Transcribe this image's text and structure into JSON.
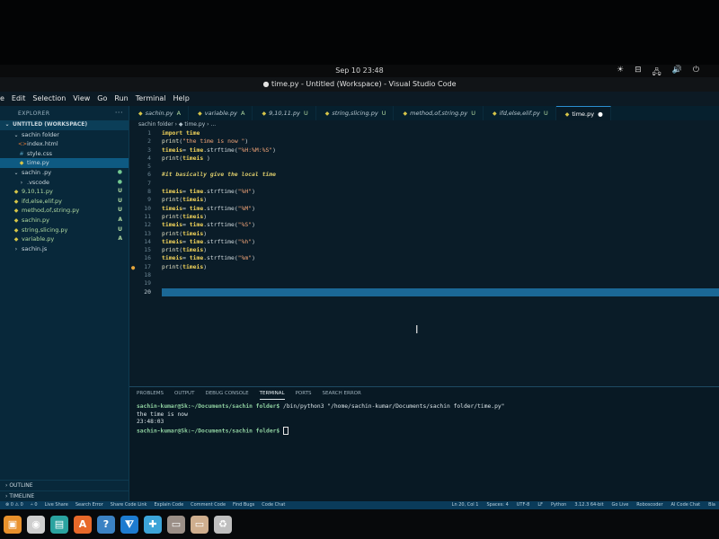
{
  "system": {
    "clock": "Sep 10  23:48",
    "tray": [
      "☀",
      "⊟",
      "🖧",
      "🔊",
      "⏻"
    ]
  },
  "window": {
    "title": "● time.py - Untitled (Workspace) - Visual Studio Code"
  },
  "menu": [
    "e",
    "Edit",
    "Selection",
    "View",
    "Go",
    "Run",
    "Terminal",
    "Help"
  ],
  "explorer": {
    "header": "EXPLORER",
    "more": "···",
    "workspace": "UNTITLED (WORKSPACE)",
    "items": [
      {
        "label": "sachin folder",
        "icon": "⌄",
        "indent": 14,
        "color": "",
        "badge": "",
        "sel": false
      },
      {
        "label": "index.html",
        "icon": "<>",
        "indent": 20,
        "color": "c-orange",
        "badge": "",
        "sel": false
      },
      {
        "label": "style.css",
        "icon": "#",
        "indent": 20,
        "color": "c-blue",
        "badge": "",
        "sel": false
      },
      {
        "label": "time.py",
        "icon": "◆",
        "indent": 20,
        "color": "c-yellow",
        "badge": "",
        "sel": true
      },
      {
        "label": "sachin .py",
        "icon": "⌄",
        "indent": 14,
        "color": "",
        "badge": "●",
        "sel": false
      },
      {
        "label": ".vscode",
        "icon": "›",
        "indent": 20,
        "color": "",
        "badge": "●",
        "sel": false
      },
      {
        "label": "9,10,11.py",
        "icon": "◆",
        "indent": 14,
        "color": "c-yellow",
        "badge": "U",
        "sel": false
      },
      {
        "label": "ifd,else,elif.py",
        "icon": "◆",
        "indent": 14,
        "color": "c-yellow",
        "badge": "U",
        "sel": false
      },
      {
        "label": "method,of,string.py",
        "icon": "◆",
        "indent": 14,
        "color": "c-yellow",
        "badge": "U",
        "sel": false
      },
      {
        "label": "sachin.py",
        "icon": "◆",
        "indent": 14,
        "color": "c-yellow",
        "badge": "A",
        "sel": false
      },
      {
        "label": "string,slicing.py",
        "icon": "◆",
        "indent": 14,
        "color": "c-yellow",
        "badge": "U",
        "sel": false
      },
      {
        "label": "variable.py",
        "icon": "◆",
        "indent": 14,
        "color": "c-yellow",
        "badge": "A",
        "sel": false
      },
      {
        "label": "sachin.js",
        "icon": "›",
        "indent": 14,
        "color": "",
        "badge": "",
        "sel": false
      }
    ],
    "outline": "OUTLINE",
    "timeline": "TIMELINE"
  },
  "tabs": [
    {
      "label": "sachin.py",
      "mark": "A",
      "active": false
    },
    {
      "label": "variable.py",
      "mark": "A",
      "active": false
    },
    {
      "label": "9,10,11.py",
      "mark": "U",
      "active": false
    },
    {
      "label": "string,slicing.py",
      "mark": "U",
      "active": false
    },
    {
      "label": "method,of,string.py",
      "mark": "U",
      "active": false
    },
    {
      "label": "ifd,else,elif.py",
      "mark": "U",
      "active": false
    },
    {
      "label": "time.py",
      "mark": "●",
      "active": true
    }
  ],
  "breadcrumb": "sachin folder  ›  ◆ time.py  ›  ...",
  "editor": {
    "lines": [
      "import time",
      "print(\"the time is now \")",
      "timeis= time.strftime(\"%H:%M:%S\")",
      "print(timeis )",
      "",
      "#it basically give the local time",
      "",
      "timeis= time.strftime(\"%H\")",
      "print(timeis)",
      "timeis= time.strftime(\"%M\")",
      "print(timeis)",
      "timeis= time.strftime(\"%S\")",
      "print(timeis)",
      "timeis= time.strftime(\"%h\")",
      "print(timeis)",
      "timeis= time.strftime(\"%m\")",
      "print(timeis)",
      "",
      "",
      ""
    ],
    "modified_line": 17,
    "current_line": 20
  },
  "panel": {
    "tabs": [
      "PROBLEMS",
      "OUTPUT",
      "DEBUG CONSOLE",
      "TERMINAL",
      "PORTS",
      "SEARCH ERROR"
    ],
    "active_tab": "TERMINAL",
    "terminal": {
      "prompt1": "sachin-kumar@Sk:~/Documents/sachin folder$",
      "cmd1": " /bin/python3 \"/home/sachin-kumar/Documents/sachin folder/time.py\"",
      "out1": "the time is now",
      "out2": "23:48:03",
      "prompt2": "sachin-kumar@Sk:~/Documents/sachin folder$"
    }
  },
  "statusbar": {
    "left": [
      "⊗ 0  ⚠ 0",
      "⑃ 0",
      "Live Share",
      "Search Error",
      "Share Code Link",
      "Explain Code",
      "Comment Code",
      "Find Bugs",
      "Code Chat"
    ],
    "right": [
      "Ln 20, Col 1",
      "Spaces: 4",
      "UTF-8",
      "LF",
      "Python",
      "3.12.3 64-bit",
      "Go Live",
      "Roboscoder",
      "AI Code Chat",
      "Bla"
    ]
  },
  "dock": [
    {
      "name": "files-icon",
      "glyph": "▣",
      "color": "#e9912c"
    },
    {
      "name": "disk-icon",
      "glyph": "◉",
      "color": "#cfcfcf"
    },
    {
      "name": "notes-icon",
      "glyph": "▤",
      "color": "#2aa3a0"
    },
    {
      "name": "software-icon",
      "glyph": "A",
      "color": "#e8692a"
    },
    {
      "name": "help-icon",
      "glyph": "?",
      "color": "#3b82c4"
    },
    {
      "name": "vscode-icon",
      "glyph": "⧨",
      "color": "#1d7bd0"
    },
    {
      "name": "extensions-icon",
      "glyph": "✚",
      "color": "#3ca4d8"
    },
    {
      "name": "app-icon-1",
      "glyph": "▭",
      "color": "#9b8f87"
    },
    {
      "name": "app-icon-2",
      "glyph": "▭",
      "color": "#cfae8e"
    },
    {
      "name": "recycle-icon",
      "glyph": "♻",
      "color": "#bfbfbf"
    }
  ]
}
